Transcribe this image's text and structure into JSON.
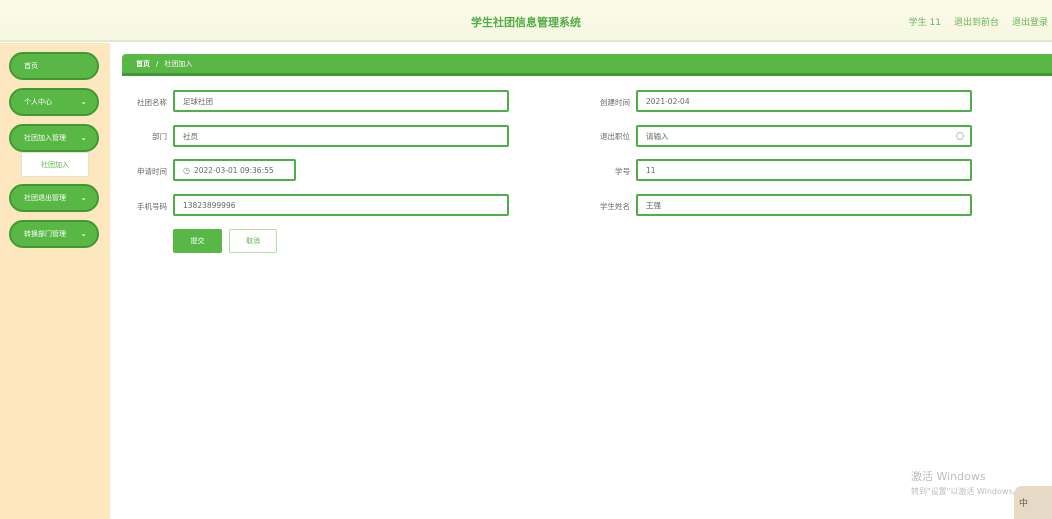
{
  "header": {
    "title": "学生社团信息管理系统",
    "user": "学生 11",
    "front_link": "退出到前台",
    "logout": "退出登录"
  },
  "sidebar": {
    "items": [
      {
        "label": "首页"
      },
      {
        "label": "个人中心",
        "chevron": "chevron-down-icon"
      },
      {
        "label": "社团加入管理",
        "chevron": "chevron-down-icon"
      },
      {
        "label": "社团退出管理",
        "chevron": "chevron-down-icon"
      },
      {
        "label": "转换部门管理",
        "chevron": "chevron-down-icon"
      }
    ],
    "sub_item": "社团加入"
  },
  "breadcrumb": {
    "home": "首页",
    "separator": "/",
    "current": "社团加入"
  },
  "form": {
    "club_name": {
      "label": "社团名称",
      "value": "足球社团"
    },
    "created_time": {
      "label": "创建时间",
      "value": "2021-02-04"
    },
    "department": {
      "label": "部门",
      "value": "社员"
    },
    "exit_position": {
      "label": "退出职位",
      "placeholder": "请输入"
    },
    "apply_time": {
      "label": "申请时间",
      "value": "2022-03-01 09:36:55"
    },
    "student_no": {
      "label": "学号",
      "value": "11"
    },
    "phone": {
      "label": "手机号码",
      "value": "13823899996"
    },
    "student_name": {
      "label": "学生姓名",
      "value": "王强"
    },
    "submit": "提交",
    "cancel": "取消"
  },
  "watermark": {
    "line1": "激活 Windows",
    "line2": "转到\"设置\"以激活 Windows。"
  },
  "ime": "中",
  "colors": {
    "accent": "#59b746",
    "sidebar_bg": "#fde7bf",
    "header_bg": "#f6f7e0"
  }
}
